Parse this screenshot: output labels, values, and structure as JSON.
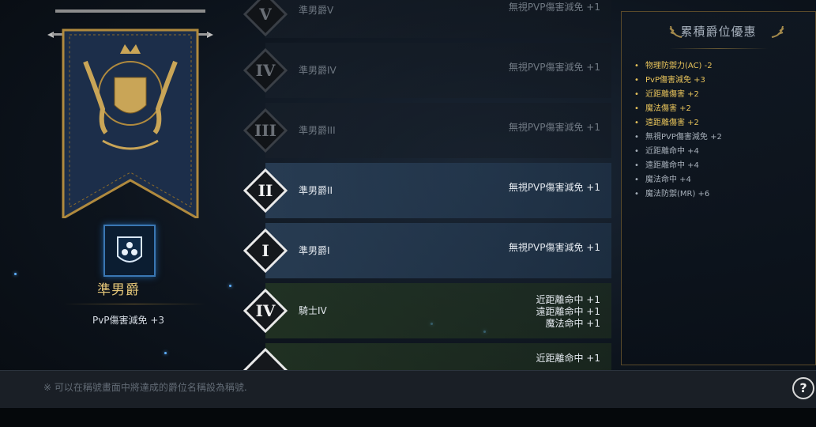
{
  "current_rank": {
    "name": "準男爵",
    "bonus": "PvP傷害減免 +3",
    "icon": "shield-orbs-icon"
  },
  "ranks": [
    {
      "numeral": "V",
      "title": "準男爵V",
      "bonus": [
        "無視PVP傷害減免 +1"
      ],
      "state": "locked"
    },
    {
      "numeral": "IV",
      "title": "準男爵IV",
      "bonus": [
        "無視PVP傷害減免 +1"
      ],
      "state": "locked"
    },
    {
      "numeral": "III",
      "title": "準男爵III",
      "bonus": [
        "無視PVP傷害減免 +1"
      ],
      "state": "locked"
    },
    {
      "numeral": "II",
      "title": "準男爵II",
      "bonus": [
        "無視PVP傷害減免 +1"
      ],
      "state": "current"
    },
    {
      "numeral": "I",
      "title": "準男爵I",
      "bonus": [
        "無視PVP傷害減免 +1"
      ],
      "state": "achieved"
    },
    {
      "numeral": "IV",
      "title": "騎士IV",
      "bonus": [
        "近距離命中 +1",
        "遠距離命中 +1",
        "魔法命中 +1"
      ],
      "state": "achieved-green"
    },
    {
      "numeral": "",
      "title": "",
      "bonus": [
        "近距離命中 +1"
      ],
      "state": "achieved-green"
    }
  ],
  "cumulative": {
    "title": "累積爵位優惠",
    "items": [
      {
        "text": "物理防禦力(AC) -2",
        "style": "gold"
      },
      {
        "text": "PvP傷害減免 +3",
        "style": "gold"
      },
      {
        "text": "近距離傷害 +2",
        "style": "gold"
      },
      {
        "text": "魔法傷害 +2",
        "style": "gold"
      },
      {
        "text": "遠距離傷害 +2",
        "style": "gold"
      },
      {
        "text": "無視PVP傷害減免 +2",
        "style": "grey"
      },
      {
        "text": "近距離命中 +4",
        "style": "grey"
      },
      {
        "text": "遠距離命中 +4",
        "style": "grey"
      },
      {
        "text": "魔法命中 +4",
        "style": "grey"
      },
      {
        "text": "魔法防禦(MR) +6",
        "style": "grey"
      }
    ]
  },
  "footer": {
    "note": "※ 可以在稱號畫面中將達成的爵位名稱設為稱號.",
    "help": "?"
  },
  "colors": {
    "gold": "#e6c25a",
    "accent_blue": "#3a77b3",
    "banner_navy": "#1c2e4a"
  }
}
